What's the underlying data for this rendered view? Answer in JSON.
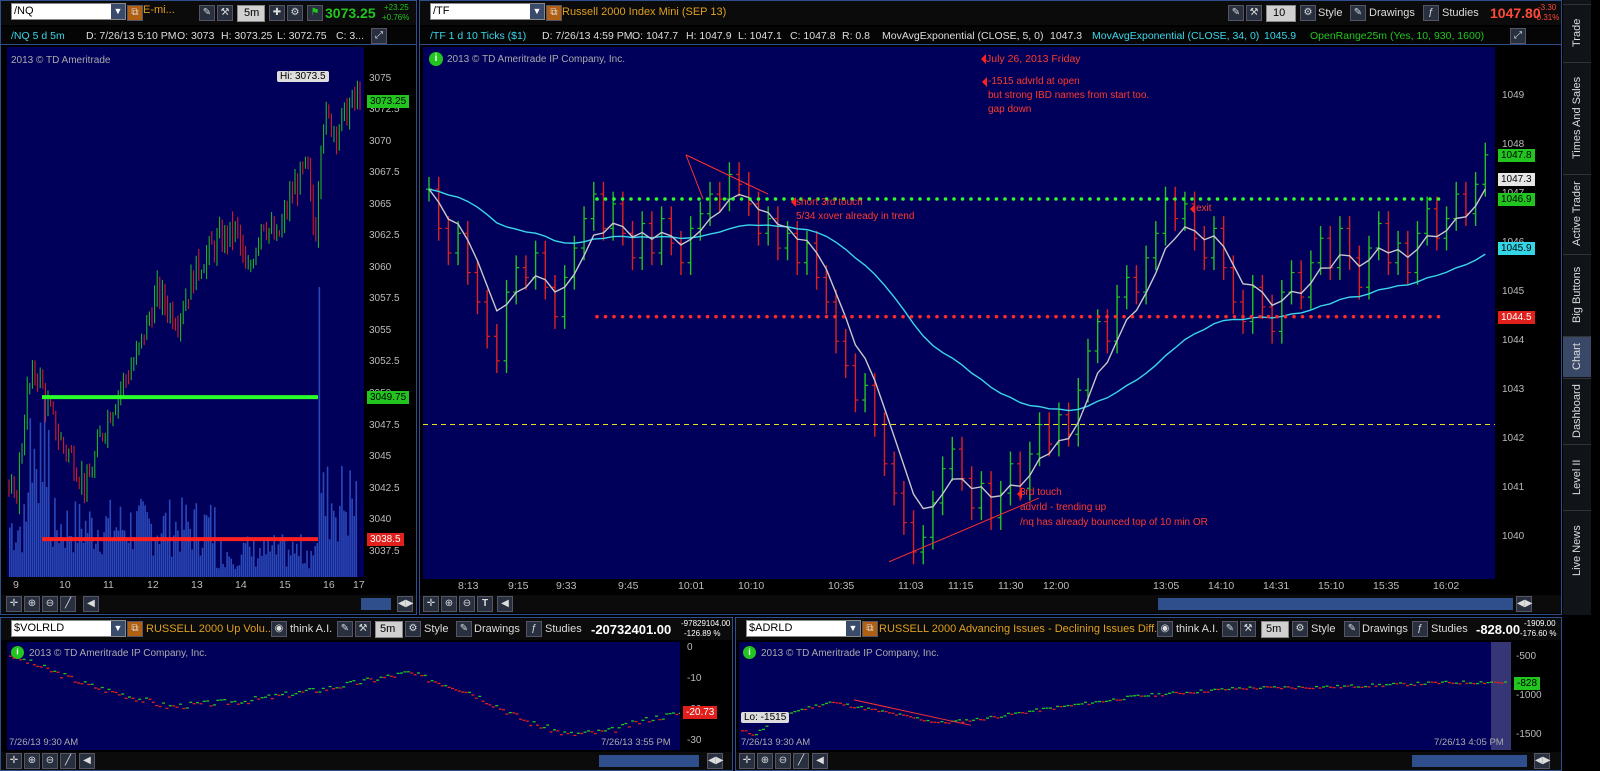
{
  "left_chart": {
    "symbol": "/NQ",
    "title": "E-mi...",
    "aggregation": "5m",
    "last_price": "3073.25",
    "change": "+23.25",
    "change_pct": "+0.76%",
    "info": {
      "period": "/NQ 5 d 5m",
      "date": "D: 7/26/13 5:10 PM",
      "open": "O: 3073",
      "high": "H: 3073.25",
      "low": "L: 3072.75",
      "close": "C: 3..."
    },
    "copyright": "2013 © TD Ameritrade",
    "hi_label": "Hi: 3073.5",
    "price_levels": [
      "3075",
      "3072.5",
      "3070",
      "3067.5",
      "3065",
      "3062.5",
      "3060",
      "3057.5",
      "3055",
      "3052.5",
      "3050",
      "3047.5",
      "3045",
      "3042.5",
      "3040",
      "3037.5"
    ],
    "price_tags": [
      {
        "label": "3073.25",
        "bg": "#22c41f"
      },
      {
        "label": "3049.75",
        "bg": "#22c41f"
      },
      {
        "label": "3038.5",
        "bg": "#e0201c"
      }
    ],
    "time_labels": [
      "9",
      "10",
      "11",
      "12",
      "13",
      "14",
      "15",
      "16",
      "17"
    ]
  },
  "main_chart": {
    "symbol": "/TF",
    "title": "Russell 2000 Index Mini (SEP 13)",
    "aggregation": "10",
    "last_price": "1047.80",
    "change": "-3.30",
    "change_pct": "-0.31%",
    "toolbar": {
      "style": "Style",
      "drawings": "Drawings",
      "studies": "Studies"
    },
    "info": {
      "period": "/TF 1 d 10 Ticks ($1)",
      "date": "D: 7/26/13 4:59 PM",
      "open": "O: 1047.7",
      "high": "H: 1047.9",
      "low": "L: 1047.1",
      "close": "C: 1047.8",
      "range": "R: 0.8",
      "mov_avg_5": "MovAvgExponential (CLOSE, 5, 0)",
      "mov_avg_5_val": "1047.3",
      "mov_avg_34": "MovAvgExponential (CLOSE, 34, 0)",
      "mov_avg_34_val": "1045.9",
      "open_range": "OpenRange25m (Yes, 10, 930, 1600)"
    },
    "copyright": "2013 © TD Ameritrade IP Company, Inc.",
    "annotations": {
      "date": "July 26, 2013  Friday",
      "note1_l1": "-1515 advrld at open",
      "note1_l2": "but strong IBD names from start too.",
      "note1_l3": "gap down",
      "short_l1": "short 3rd touch",
      "short_l2": "5/34 xover already in trend",
      "exit": "exit",
      "touch_l1": "3rd touch",
      "touch_l2": "advrld - trending up",
      "touch_l3": "/nq has already bounced top of 10 min OR"
    },
    "price_levels": [
      "1049",
      "1048",
      "1047",
      "1046",
      "1045",
      "1044",
      "1043",
      "1042",
      "1041",
      "1040"
    ],
    "price_tags": [
      {
        "label": "1047.8",
        "bg": "#22c41f",
        "fg": "#000"
      },
      {
        "label": "1047.3",
        "bg": "#e6e6e6",
        "fg": "#000"
      },
      {
        "label": "1046.9",
        "bg": "#22c41f",
        "fg": "#000"
      },
      {
        "label": "1045.9",
        "bg": "#33d6e6",
        "fg": "#000"
      },
      {
        "label": "1044.5",
        "bg": "#e0201c",
        "fg": "#fff"
      }
    ],
    "time_labels": [
      "8:13",
      "9:15",
      "9:33",
      "9:45",
      "10:01",
      "10:10",
      "10:35",
      "11:03",
      "11:15",
      "11:30",
      "12:00",
      "13:05",
      "14:10",
      "14:31",
      "15:10",
      "15:35",
      "16:02"
    ]
  },
  "side_tabs": [
    "Trade",
    "Times And Sales",
    "Active Trader",
    "Big Buttons",
    "Chart",
    "Dashboard",
    "Level II",
    "Live News"
  ],
  "vol_chart": {
    "symbol": "$VOLRLD",
    "title": "RUSSELL 2000 Up Volu...",
    "think": "think A.I.",
    "aggregation": "5m",
    "style": "Style",
    "drawings": "Drawings",
    "studies": "Studies",
    "last": "-20732401.00",
    "change": "-97829104.00",
    "change_pct": "-126.89 %",
    "copyright": "2013 © TD Ameritrade IP Company, Inc.",
    "levels": [
      "0",
      "-10",
      "-20",
      "-30"
    ],
    "price_tag": "-20.73",
    "time_start": "7/26/13 9:30 AM",
    "time_end": "7/26/13 3:55 PM"
  },
  "adr_chart": {
    "symbol": "$ADRLD",
    "title": "RUSSELL 2000 Advancing Issues - Declining Issues Diff...",
    "think": "think A.I.",
    "aggregation": "5m",
    "style": "Style",
    "drawings": "Drawings",
    "studies": "Studies",
    "last": "-828.00",
    "change": "-1909.00",
    "change_pct": "-176.60 %",
    "copyright": "2013 © TD Ameritrade IP Company, Inc.",
    "levels": [
      "-500",
      "-1000",
      "-1500"
    ],
    "price_tag": "-828",
    "lo_label": "Lo: -1515",
    "time_start": "7/26/13 9:30 AM",
    "time_end": "7/26/13 4:05 PM"
  },
  "colors": {
    "bg": "#00005a",
    "up": "#22c41f",
    "down": "#e0201c",
    "ema5": "#c8c8c8",
    "ema34": "#3ad6ea",
    "accent": "#2e4f8c"
  }
}
